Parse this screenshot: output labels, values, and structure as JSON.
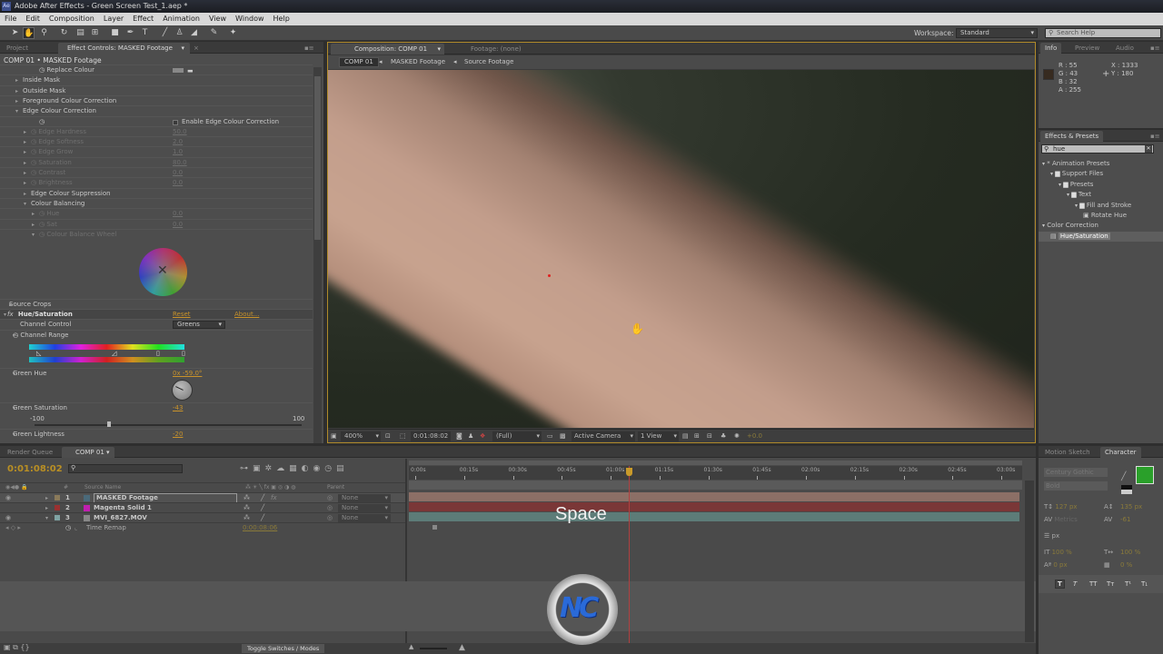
{
  "app": {
    "title": "Adobe After Effects - Green Screen Test_1.aep *",
    "icon": "Ae"
  },
  "menu": [
    "File",
    "Edit",
    "Composition",
    "Layer",
    "Effect",
    "Animation",
    "View",
    "Window",
    "Help"
  ],
  "toolbar": {
    "tools": [
      "selection-tool",
      "hand-tool",
      "zoom-tool",
      "rotate-tool",
      "camera-tool",
      "pan-behind-tool",
      "rectangle-tool",
      "pen-tool",
      "type-tool",
      "brush-tool",
      "clone-stamp-tool",
      "eraser-tool",
      "roto-brush-tool",
      "puppet-pin-tool"
    ],
    "workspace_label": "Workspace:",
    "workspace_value": "Standard",
    "search_placeholder": "Search Help"
  },
  "effect_controls": {
    "tabs": [
      "Project",
      "Effect Controls: MASKED Footage"
    ],
    "header": "COMP 01 • MASKED Footage",
    "rows": [
      {
        "label": "Replace Colour",
        "indent": 3,
        "dim": false,
        "stopwatch": true
      },
      {
        "label": "Inside Mask",
        "indent": 1,
        "twirl": "closed"
      },
      {
        "label": "Outside Mask",
        "indent": 1,
        "twirl": "closed"
      },
      {
        "label": "Foreground Colour Correction",
        "indent": 1,
        "twirl": "closed"
      },
      {
        "label": "Edge Colour Correction",
        "indent": 1,
        "twirl": "open"
      },
      {
        "label": "",
        "indent": 3,
        "checkbox_label": "Enable Edge Colour Correction",
        "stopwatch": true
      },
      {
        "label": "Edge Hardness",
        "value": "50.0",
        "indent": 2,
        "dim": true,
        "twirl": "closed"
      },
      {
        "label": "Edge Softness",
        "value": "2.0",
        "indent": 2,
        "dim": true,
        "twirl": "closed"
      },
      {
        "label": "Edge Grow",
        "value": "1.0",
        "indent": 2,
        "dim": true,
        "twirl": "closed"
      },
      {
        "label": "Saturation",
        "value": "80.0",
        "indent": 2,
        "dim": true,
        "twirl": "closed"
      },
      {
        "label": "Contrast",
        "value": "0.0",
        "indent": 2,
        "dim": true,
        "twirl": "closed"
      },
      {
        "label": "Brightness",
        "value": "0.0",
        "indent": 2,
        "dim": true,
        "twirl": "closed"
      },
      {
        "label": "Edge Colour Suppression",
        "indent": 2,
        "twirl": "closed"
      },
      {
        "label": "Colour Balancing",
        "indent": 2,
        "twirl": "open"
      },
      {
        "label": "Hue",
        "value": "0.0",
        "indent": 3,
        "dim": true,
        "twirl": "closed"
      },
      {
        "label": "Sat",
        "value": "0.0",
        "indent": 3,
        "dim": true,
        "twirl": "closed"
      },
      {
        "label": "Colour Balance Wheel",
        "indent": 3,
        "dim": true,
        "twirl": "open"
      }
    ],
    "source_crops": "Source Crops",
    "hue_sat": {
      "name": "Hue/Saturation",
      "reset": "Reset",
      "about": "About...",
      "channel_control_label": "Channel Control",
      "channel_control_value": "Greens",
      "channel_range_label": "Channel Range",
      "green_hue_label": "Green Hue",
      "green_hue_value": "0x -59.0°",
      "green_saturation_label": "Green Saturation",
      "green_saturation_value": "-43",
      "sat_min": "-100",
      "sat_max": "100",
      "green_lightness_label": "Green Lightness",
      "green_lightness_value": "-20"
    }
  },
  "composition": {
    "tabs": [
      "Composition: COMP 01",
      "Footage: (none)"
    ],
    "breadcrumbs": [
      "COMP 01",
      "MASKED Footage",
      "Source Footage"
    ],
    "footer": {
      "zoom": "400%",
      "timecode": "0:01:08:02",
      "resolution": "(Full)",
      "camera": "Active Camera",
      "views": "1 View",
      "exposure": "+0.0"
    }
  },
  "info": {
    "tabs": [
      "Info",
      "Preview",
      "Audio"
    ],
    "r": "R : 55",
    "g": "G : 43",
    "b": "B : 32",
    "a": "A : 255",
    "x": "X : 1333",
    "y": "Y : 180",
    "swatch_color": "#372b20"
  },
  "effects_presets": {
    "title": "Effects & Presets",
    "search_value": "hue",
    "tree": [
      {
        "label": "* Animation Presets",
        "level": 0,
        "type": "group"
      },
      {
        "label": "Support Files",
        "level": 1,
        "type": "folder"
      },
      {
        "label": "Presets",
        "level": 2,
        "type": "folder"
      },
      {
        "label": "Text",
        "level": 3,
        "type": "folder"
      },
      {
        "label": "Fill and Stroke",
        "level": 4,
        "type": "folder"
      },
      {
        "label": "Rotate Hue",
        "level": 5,
        "type": "preset"
      },
      {
        "label": "Color Correction",
        "level": 0,
        "type": "group"
      },
      {
        "label": "Hue/Saturation",
        "level": 1,
        "type": "effect",
        "selected": true
      }
    ]
  },
  "timeline": {
    "tabs": [
      "Render Queue",
      "COMP 01"
    ],
    "current_time": "0:01:08:02",
    "columns": {
      "source_name": "Source Name",
      "parent": "Parent",
      "number": "#"
    },
    "layers": [
      {
        "num": "1",
        "name": "MASKED Footage",
        "label_color": "#8a7a5a",
        "icon_color": "#4a6a7a",
        "parent": "None",
        "fx": true,
        "bar_color": "#8c6f66"
      },
      {
        "num": "2",
        "name": "Magenta Solid 1",
        "label_color": "#9a3030",
        "icon_color": "#c020b0",
        "parent": "None",
        "fx": false,
        "bar_color": "#7a3737"
      },
      {
        "num": "3",
        "name": "MVI_6827.MOV",
        "label_color": "#7fa3a3",
        "icon_color": "#888",
        "parent": "None",
        "fx": false,
        "bar_color": "#5d7c78"
      }
    ],
    "time_remap": {
      "label": "Time Remap",
      "value": "0:00:08:06"
    },
    "ruler": [
      "0:00s",
      "00:15s",
      "00:30s",
      "00:45s",
      "01:00s",
      "01:15s",
      "01:30s",
      "01:45s",
      "02:00s",
      "02:15s",
      "02:30s",
      "02:45s",
      "03:00s"
    ],
    "playhead_fraction": 0.378,
    "toggle_label": "Toggle Switches / Modes",
    "overlay_key": "Space"
  },
  "character": {
    "tabs": [
      "Motion Sketch",
      "Character"
    ],
    "font": "Century Gothic",
    "style": "Bold",
    "font_size": "127 px",
    "leading": "135 px",
    "kerning": "Metrics",
    "tracking": "-61",
    "stroke_width": "px",
    "vscale": "100 %",
    "hscale": "100 %",
    "baseline": "0 px",
    "tsume": "0 %",
    "fill_color": "#2aa02a",
    "style_buttons": [
      "T",
      "T",
      "TT",
      "Tт",
      "T¹",
      "T₁"
    ]
  },
  "watermark": {
    "text": "NC"
  }
}
